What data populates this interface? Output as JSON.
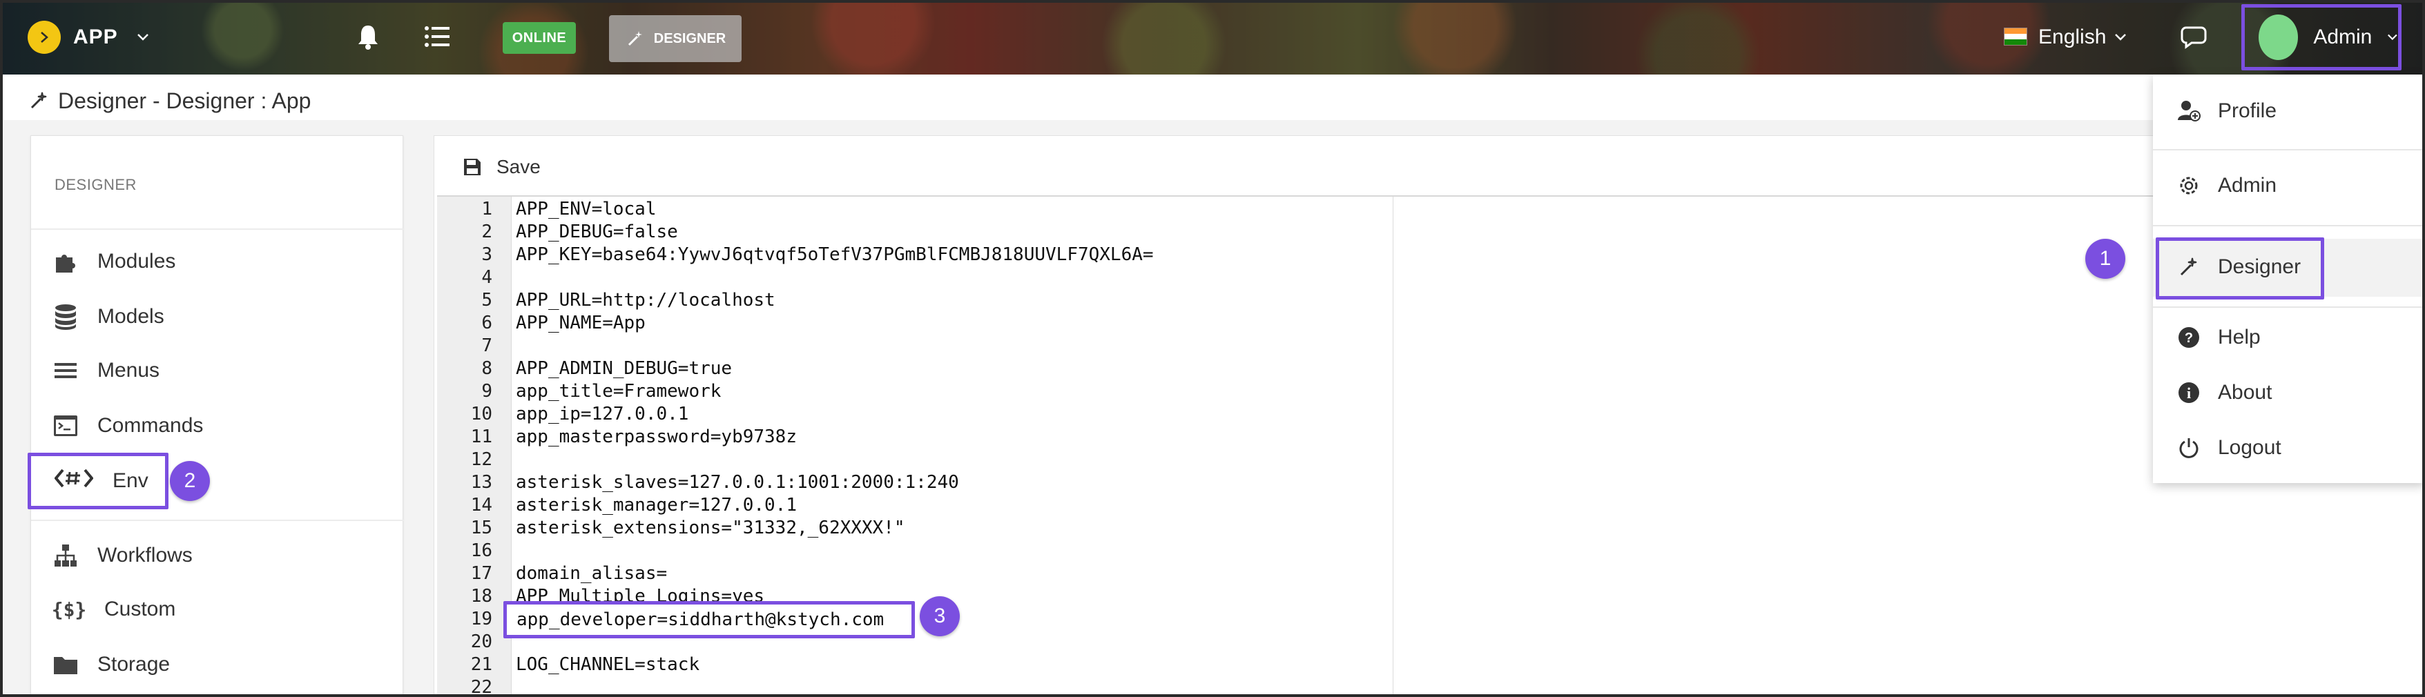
{
  "topbar": {
    "app_name": "APP",
    "status_badge": "ONLINE",
    "designer_label": "DESIGNER",
    "language": "English",
    "user": "Admin"
  },
  "breadcrumb": "Designer - Designer : App",
  "sidebar": {
    "title": "DESIGNER",
    "items": [
      {
        "label": "Modules",
        "icon": "puzzle-icon"
      },
      {
        "label": "Models",
        "icon": "database-icon"
      },
      {
        "label": "Menus",
        "icon": "menu-icon"
      },
      {
        "label": "Commands",
        "icon": "terminal-icon"
      },
      {
        "label": "Env",
        "icon": "env-code-icon"
      },
      {
        "label": "Workflows",
        "icon": "sitemap-icon"
      },
      {
        "label": "Custom",
        "icon": "braces-icon"
      },
      {
        "label": "Storage",
        "icon": "folder-icon"
      }
    ]
  },
  "toolbar": {
    "save_label": "Save"
  },
  "editor": {
    "lines": [
      "APP_ENV=local",
      "APP_DEBUG=false",
      "APP_KEY=base64:YywvJ6qtvqf5oTefV37PGmBlFCMBJ818UUVLF7QXL6A=",
      "",
      "APP_URL=http://localhost",
      "APP_NAME=App",
      "",
      "APP_ADMIN_DEBUG=true",
      "app_title=Framework",
      "app_ip=127.0.0.1",
      "app_masterpassword=yb9738z",
      "",
      "asterisk_slaves=127.0.0.1:1001:2000:1:240",
      "asterisk_manager=127.0.0.1",
      "asterisk_extensions=\"31332,_62XXXX!\"",
      "",
      "domain_alisas=",
      "APP_Multiple_Logins=yes",
      "app_developer=siddharth@kstych.com",
      "",
      "LOG_CHANNEL=stack",
      ""
    ],
    "numbers": [
      "1",
      "2",
      "3",
      "4",
      "5",
      "6",
      "7",
      "8",
      "9",
      "10",
      "11",
      "12",
      "13",
      "14",
      "15",
      "16",
      "17",
      "18",
      "19",
      "20",
      "21",
      "22"
    ]
  },
  "user_menu": {
    "items": [
      {
        "label": "Profile",
        "icon": "add-user-icon"
      },
      {
        "label": "Admin",
        "icon": "gear-icon"
      },
      {
        "label": "Designer",
        "icon": "magic-wand-icon"
      },
      {
        "label": "Help",
        "icon": "help-icon"
      },
      {
        "label": "About",
        "icon": "info-icon"
      },
      {
        "label": "Logout",
        "icon": "power-icon"
      }
    ]
  },
  "callouts": [
    "1",
    "2",
    "3"
  ],
  "colors": {
    "accent": "#7b4fe0",
    "online": "#4caf50",
    "logo": "#f3c613"
  }
}
